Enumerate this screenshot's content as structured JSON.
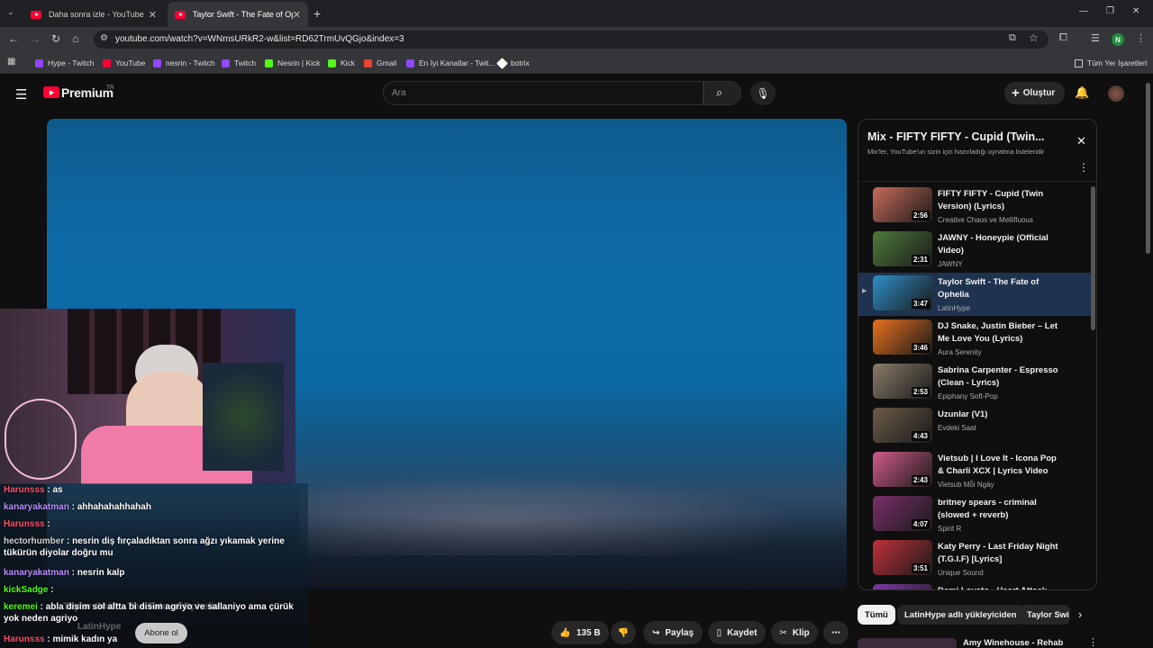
{
  "browser": {
    "tabs": [
      {
        "title": "Daha sonra izle - YouTube",
        "active": false
      },
      {
        "title": "Taylor Swift - The Fate of Ophelia",
        "active": true
      }
    ],
    "url": "youtube.com/watch?v=WNmsURkR2-w&list=RD62TrmUvQGjo&index=3",
    "profile_initial": "N",
    "bookmarks": [
      {
        "label": "Hype - Twitch",
        "color": "#9146ff"
      },
      {
        "label": "YouTube",
        "color": "#ff0033"
      },
      {
        "label": "nesrin - Twitch",
        "color": "#9146ff"
      },
      {
        "label": "Twitch",
        "color": "#9146ff"
      },
      {
        "label": "Nesrin | Kick",
        "color": "#53fc18"
      },
      {
        "label": "Kick",
        "color": "#53fc18"
      },
      {
        "label": "Gmail",
        "color": "#ea4335"
      },
      {
        "label": "En İyi Kanallar - Twit...",
        "color": "#9146ff"
      },
      {
        "label": "botrix",
        "color": "#ffffff"
      }
    ],
    "all_bookmarks": "Tüm Yer İşaretleri"
  },
  "youtube": {
    "logo_text": "Premium",
    "region": "TR",
    "search_placeholder": "Ara",
    "create_label": "Oluştur",
    "subscribe_label": "Abone ol",
    "channel_name": "LatinHype",
    "overlay_title": "Taylor Swift - The Fate of Ophelia"
  },
  "actions": {
    "likes": "135 B",
    "share": "Paylaş",
    "save": "Kaydet",
    "clip": "Klip"
  },
  "playlist": {
    "title": "Mix - FIFTY FIFTY - Cupid (Twin...",
    "subtitle": "Mix'ler, YouTube'un sizin için hazırladığı oynatma listeleridir",
    "items": [
      {
        "title": "FIFTY FIFTY - Cupid (Twin Version) (Lyrics)",
        "channel": "Creative Chaos ve Mellifluous",
        "duration": "2:56",
        "color": "#c86a5a"
      },
      {
        "title": "JAWNY - Honeypie (Official Video)",
        "channel": "JAWNY",
        "duration": "2:31",
        "color": "#4e7a3a"
      },
      {
        "title": "Taylor Swift - The Fate of Ophelia",
        "channel": "LatinHype",
        "duration": "3:47",
        "color": "#2f8fc9",
        "current": true
      },
      {
        "title": "DJ Snake, Justin Bieber – Let Me Love You (Lyrics)",
        "channel": "Aura Serenity",
        "duration": "3:46",
        "color": "#e8701e"
      },
      {
        "title": "Sabrina Carpenter - Espresso (Clean - Lyrics)",
        "channel": "Epiphany Soft-Pop",
        "duration": "2:53",
        "color": "#8a7c6a"
      },
      {
        "title": "Uzunlar (V1)",
        "channel": "Evdeki Saat",
        "duration": "4:43",
        "color": "#6b5c48"
      },
      {
        "title": "Vietsub | I Love It - Icona Pop & Charli XCX | Lyrics Video",
        "channel": "Vietsub Mỗi Ngày",
        "duration": "2:43",
        "color": "#d05a8a"
      },
      {
        "title": "britney spears - criminal (slowed + reverb)",
        "channel": "Spirit R",
        "duration": "4:07",
        "color": "#7a2f6a"
      },
      {
        "title": "Katy Perry - Last Friday Night (T.G.I.F) [Lyrics]",
        "channel": "Unique Sound",
        "duration": "3:51",
        "color": "#c0303a"
      },
      {
        "title": "Demi Lovato - Heart Attack",
        "channel": "",
        "duration": "",
        "color": "#7a3aa0"
      }
    ]
  },
  "chips": [
    "Tümü",
    "LatinHype adlı yükleyiciden",
    "Taylor Swi"
  ],
  "next_item": "Amy Winehouse - Rehab",
  "chat": [
    {
      "user": "Harunsss",
      "text": ": as",
      "color": "#ff4d6d"
    },
    {
      "user": "kanaryakatman",
      "text": ": ahhahahahhahah",
      "color": "#b98cff"
    },
    {
      "user": "Harunsss",
      "text": ": ",
      "color": "#ff4d6d"
    },
    {
      "user": "hectorhumber",
      "text": ": nesrin diş fırçaladıktan sonra ağzı yıkamak yerine tükürün diyolar doğru mu",
      "color": "#d0d0d0"
    },
    {
      "user": "kanaryakatman",
      "text": ": nesrin kalp",
      "color": "#b98cff"
    },
    {
      "user": "kickSadge",
      "text": ": ",
      "color": "#53fc18"
    },
    {
      "user": "keremei",
      "text": ": abla disim sol altta bi disim agriyo ve sallaniyo ama çürük yok neden agriyo",
      "color": "#53fc18"
    },
    {
      "user": "Harunsss",
      "text": ": mimik kadın ya",
      "color": "#ff4d6d"
    }
  ]
}
